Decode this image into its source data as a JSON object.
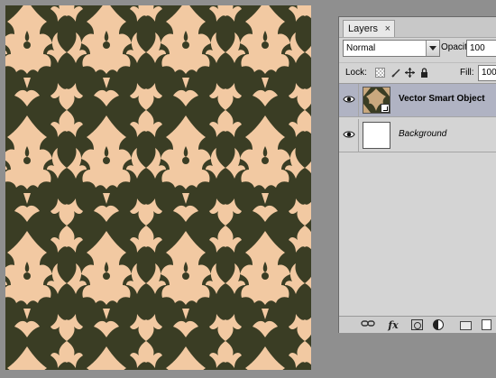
{
  "colors": {
    "workspace_bg": "#8f8f8f",
    "pattern_dark": "#3a3d24",
    "pattern_light": "#f2c9a2",
    "selected_layer": "#b0b3c3",
    "panel_bg": "#d4d4d4"
  },
  "layers_panel": {
    "tab_label": "Layers",
    "tab_close": "×",
    "blend_mode": "Normal",
    "opacity_label": "Opacity:",
    "opacity_value": "100",
    "lock_label": "Lock:",
    "fill_label": "Fill:",
    "fill_value": "100",
    "layers": [
      {
        "name": "Vector Smart Object",
        "visible": true,
        "selected": true,
        "icon": "smart-object-thumbnail"
      },
      {
        "name": "Background",
        "visible": true,
        "selected": false,
        "icon": "white-thumbnail"
      }
    ],
    "footer_icons": {
      "link": "link-icon",
      "fx": "fx",
      "mask": "mask-icon",
      "adjustment": "adjustment-icon",
      "group": "folder-icon",
      "new_layer": "new-layer-icon"
    }
  }
}
